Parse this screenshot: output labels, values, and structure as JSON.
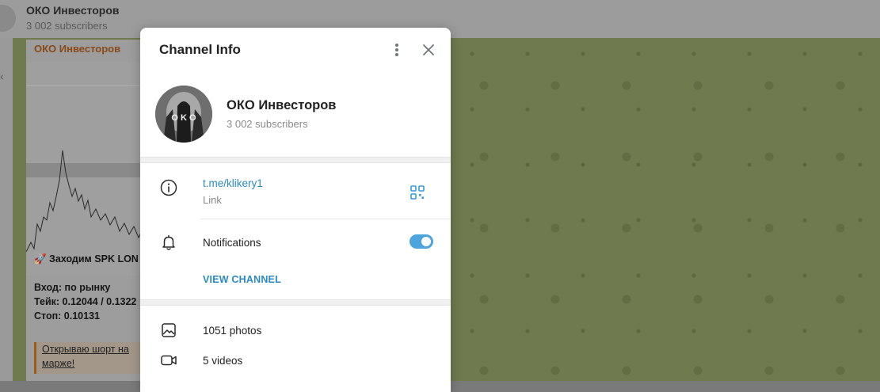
{
  "background": {
    "chat_title": "ОКО Инвесторов",
    "chat_subscribers": "3 002 subscribers",
    "post": {
      "author": "ОКО Инвесторов",
      "line1": "🚀 Заходим SPK LON",
      "line2": "Вход: по рынку",
      "line3": "Тейк: 0.12044 / 0.1322",
      "line4": "Стоп: 0.10131",
      "quote_line1": "Открываю шорт на",
      "quote_line2": "марже!"
    },
    "wallpaper_color": "#6f7a4e"
  },
  "modal": {
    "title": "Channel Info",
    "more_icon": "more-vertical-icon",
    "close_icon": "close-icon",
    "profile": {
      "name": "ОКО Инвесторов",
      "subscribers": "3 002 subscribers",
      "avatar_text": "O K O"
    },
    "info": {
      "icon": "info-icon",
      "link": "t.me/klikery1",
      "link_caption": "Link",
      "qr_icon": "qr-code-icon"
    },
    "notifications": {
      "icon": "bell-icon",
      "label": "Notifications",
      "enabled": true
    },
    "view_channel_label": "VIEW CHANNEL",
    "media": [
      {
        "icon": "photo-icon",
        "label": "1051 photos"
      },
      {
        "icon": "video-icon",
        "label": "5 videos"
      }
    ],
    "accent_color": "#2a8ac6",
    "toggle_color": "#4ea4dc"
  }
}
